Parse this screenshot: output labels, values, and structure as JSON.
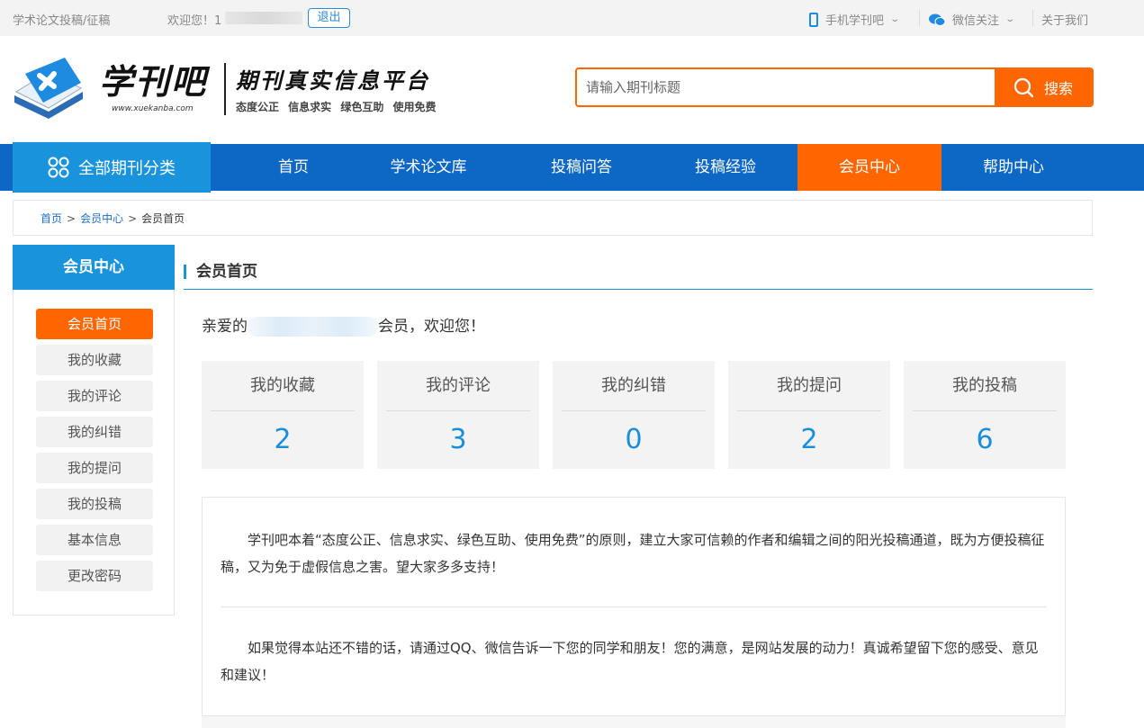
{
  "topbar": {
    "site_tagline": "学术论文投稿/征稿",
    "welcome": "欢迎您！1",
    "logout": "退出",
    "mobile": "手机学刊吧",
    "wechat": "微信关注",
    "about": "关于我们"
  },
  "header": {
    "logo_name": "学刊吧",
    "logo_url": "www.xuekanba.com",
    "logo_slogan": "期刊真实信息平台",
    "logo_tags": "态度公正 信息求实 绿色互助 使用免费",
    "search_placeholder": "请输入期刊标题",
    "search_button": "搜索"
  },
  "nav": {
    "all_categories": "全部期刊分类",
    "items": [
      {
        "label": "首页"
      },
      {
        "label": "学术论文库"
      },
      {
        "label": "投稿问答"
      },
      {
        "label": "投稿经验"
      },
      {
        "label": "会员中心"
      },
      {
        "label": "帮助中心"
      }
    ],
    "active_index": 4
  },
  "breadcrumb": {
    "home": "首页",
    "member": "会员中心",
    "current": "会员首页",
    "separator": ">"
  },
  "sidebar": {
    "title": "会员中心",
    "items": [
      {
        "label": "会员首页"
      },
      {
        "label": "我的收藏"
      },
      {
        "label": "我的评论"
      },
      {
        "label": "我的纠错"
      },
      {
        "label": "我的提问"
      },
      {
        "label": "我的投稿"
      },
      {
        "label": "基本信息"
      },
      {
        "label": "更改密码"
      }
    ],
    "active_index": 0
  },
  "main": {
    "title": "会员首页",
    "greeting_prefix": "亲爱的",
    "greeting_suffix": "会员，欢迎您！",
    "stats": [
      {
        "label": "我的收藏",
        "value": "2"
      },
      {
        "label": "我的评论",
        "value": "3"
      },
      {
        "label": "我的纠错",
        "value": "0"
      },
      {
        "label": "我的提问",
        "value": "2"
      },
      {
        "label": "我的投稿",
        "value": "6"
      }
    ],
    "notice_1": "学刊吧本着“态度公正、信息求实、绿色互助、使用免费”的原则，建立大家可信赖的作者和编辑之间的阳光投稿通道，既为方便投稿征稿，又为免于虚假信息之害。望大家多多支持！",
    "notice_2": "如果觉得本站还不错的话，请通过QQ、微信告诉一下您的同学和朋友！您的满意，是网站发展的动力！真诚希望留下您的感受、意见和建议！"
  },
  "colors": {
    "primary_blue": "#0d67c5",
    "light_blue": "#1a93dd",
    "accent_orange": "#ff6600"
  }
}
